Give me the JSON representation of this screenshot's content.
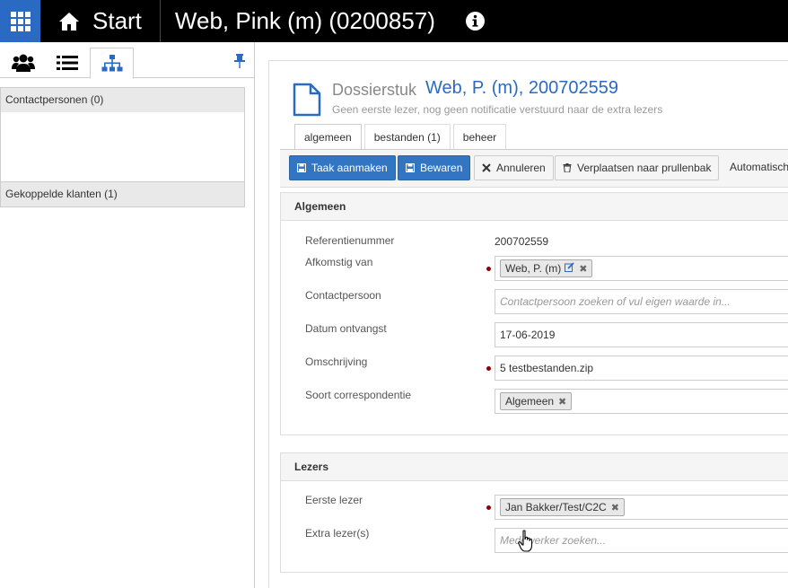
{
  "topbar": {
    "start_label": "Start",
    "page_name": "Web, Pink (m) (0200857)"
  },
  "sidebar": {
    "sections": [
      {
        "label": "Contactpersonen (0)"
      },
      {
        "label": "Gekoppelde klanten (1)"
      }
    ]
  },
  "document": {
    "type_label": "Dossierstuk",
    "title": "Web, P. (m), 200702559",
    "subtitle": "Geen eerste lezer, nog geen notificatie verstuurd naar de extra lezers"
  },
  "tabs": [
    {
      "label": "algemeen"
    },
    {
      "label": "bestanden (1)"
    },
    {
      "label": "beheer"
    }
  ],
  "toolbar": {
    "task_label": "Taak aanmaken",
    "save_label": "Bewaren",
    "cancel_label": "Annuleren",
    "trash_label": "Verplaatsen naar prullenbak",
    "auto_label": "Automatisch"
  },
  "general": {
    "heading": "Algemeen",
    "reference_label": "Referentienummer",
    "reference_value": "200702559",
    "origin_label": "Afkomstig van",
    "origin_chip": "Web, P. (m)",
    "contact_label": "Contactpersoon",
    "contact_placeholder": "Contactpersoon zoeken of vul eigen waarde in...",
    "date_label": "Datum ontvangst",
    "date_value": "17-06-2019",
    "description_label": "Omschrijving",
    "description_value": "5 testbestanden.zip",
    "type_label": "Soort correspondentie",
    "type_chip": "Algemeen"
  },
  "readers": {
    "heading": "Lezers",
    "first_label": "Eerste lezer",
    "first_chip": "Jan Bakker/Test/C2C",
    "extra_label": "Extra lezer(s)",
    "extra_placeholder": "Medewerker zoeken..."
  },
  "colors": {
    "brand_blue": "#2a6ac2",
    "button_blue": "#3276c3",
    "required_dot": "#8b0000"
  }
}
